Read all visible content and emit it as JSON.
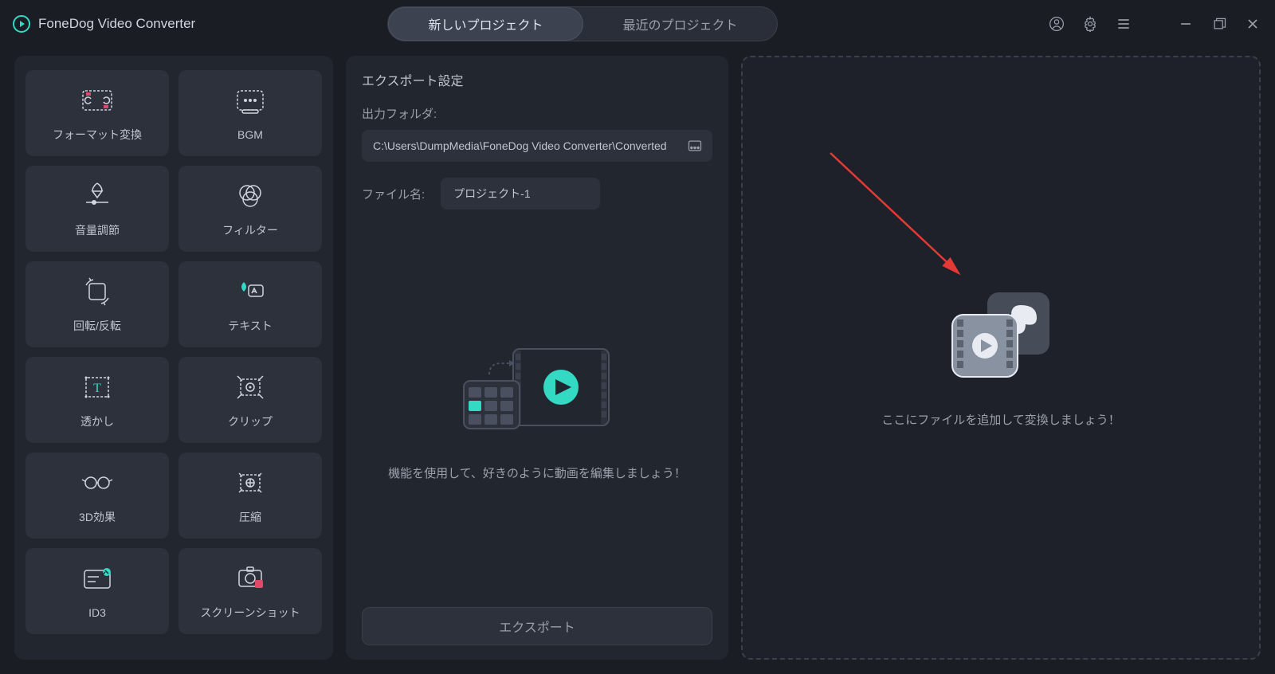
{
  "app": {
    "title": "FoneDog Video Converter"
  },
  "tabs": {
    "new_project": "新しいプロジェクト",
    "recent_projects": "最近のプロジェクト"
  },
  "sidebar": {
    "tools": [
      {
        "label": "フォーマット変換",
        "icon": "format-convert"
      },
      {
        "label": "BGM",
        "icon": "bgm"
      },
      {
        "label": "音量調節",
        "icon": "volume"
      },
      {
        "label": "フィルター",
        "icon": "filter"
      },
      {
        "label": "回転/反転",
        "icon": "rotate"
      },
      {
        "label": "テキスト",
        "icon": "text"
      },
      {
        "label": "透かし",
        "icon": "watermark"
      },
      {
        "label": "クリップ",
        "icon": "clip"
      },
      {
        "label": "3D効果",
        "icon": "3d"
      },
      {
        "label": "圧縮",
        "icon": "compress"
      },
      {
        "label": "ID3",
        "icon": "id3"
      },
      {
        "label": "スクリーンショット",
        "icon": "screenshot"
      }
    ]
  },
  "export": {
    "title": "エクスポート設定",
    "folder_label": "出力フォルダ:",
    "folder_path": "C:\\Users\\DumpMedia\\FoneDog Video Converter\\Converted",
    "filename_label": "ファイル名:",
    "filename_value": "プロジェクト-1",
    "hint": "機能を使用して、好きのように動画を編集しましょう！",
    "export_button": "エクスポート"
  },
  "drop": {
    "hint": "ここにファイルを追加して変換しましょう！"
  }
}
